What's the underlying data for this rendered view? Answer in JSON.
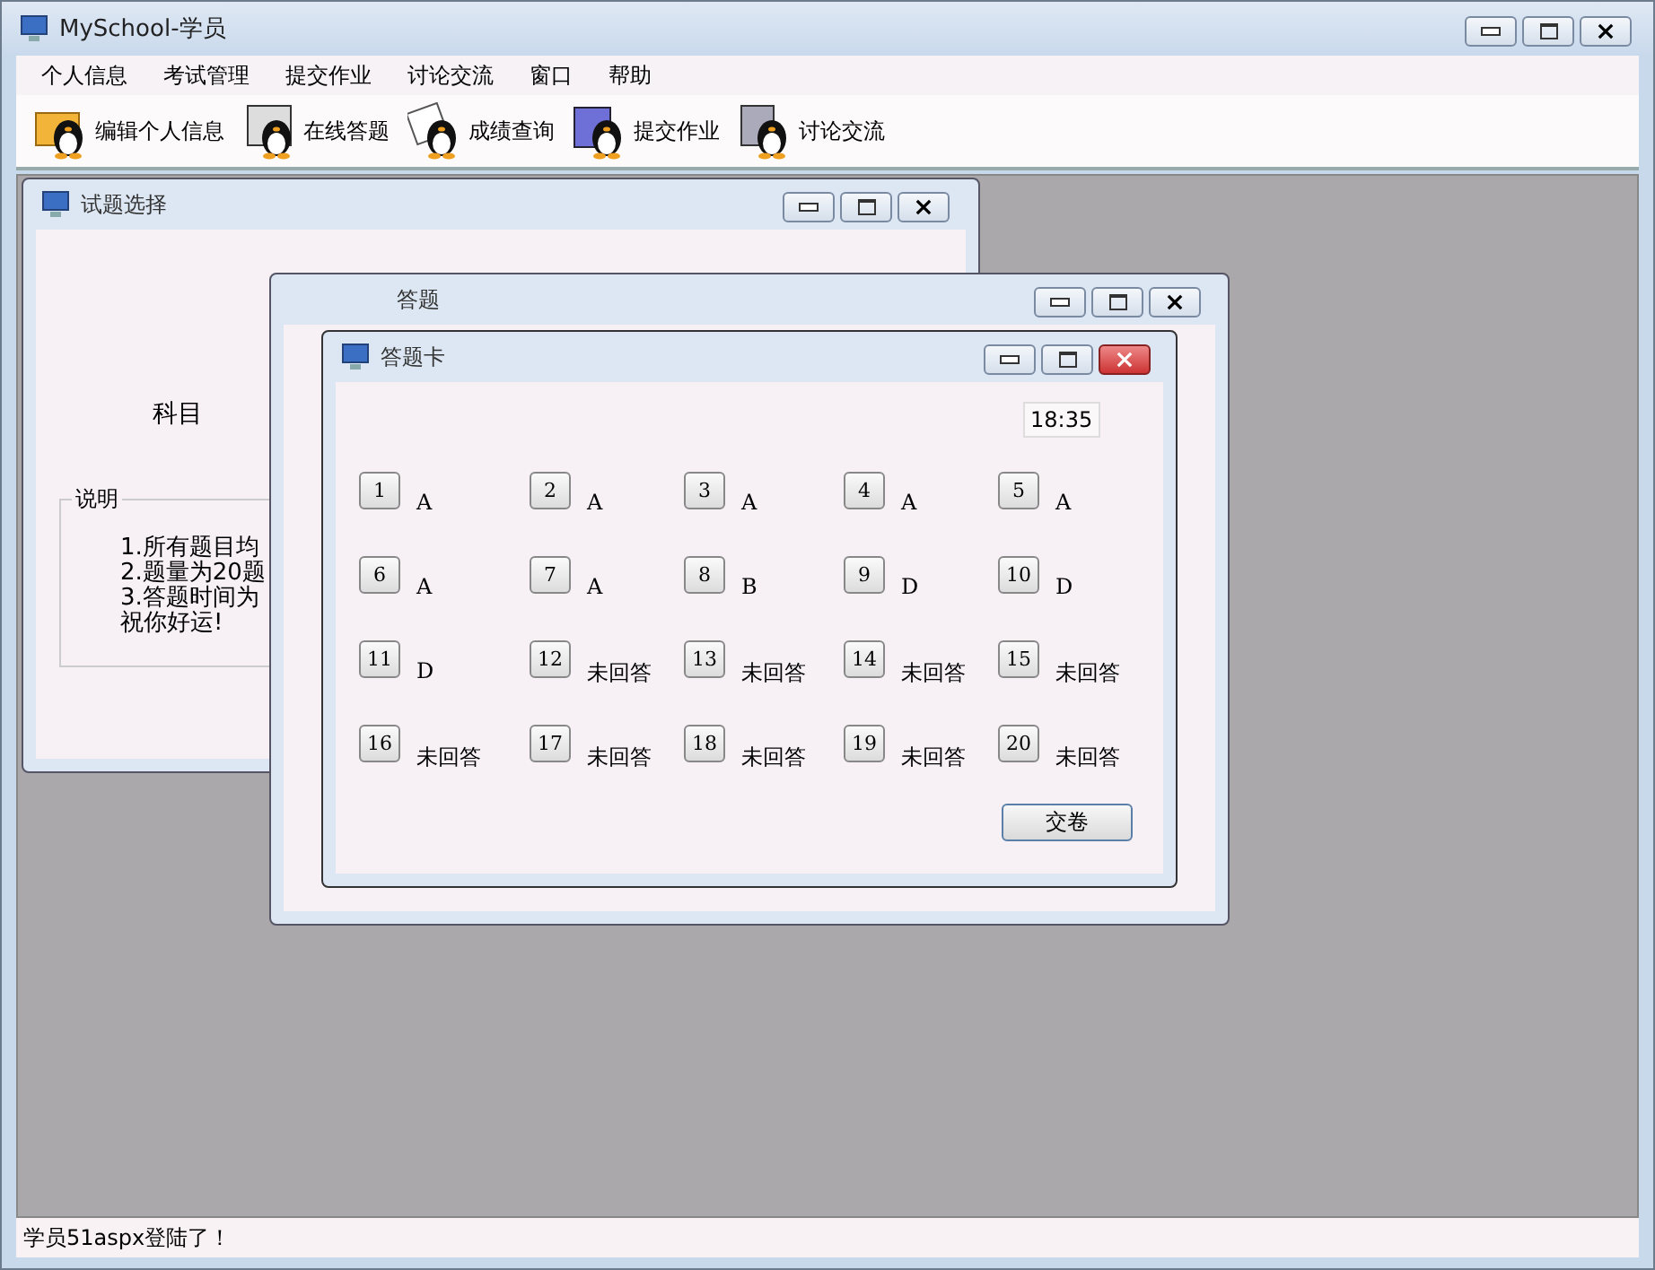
{
  "window": {
    "title": "MySchool-学员"
  },
  "menu": [
    "个人信息",
    "考试管理",
    "提交作业",
    "讨论交流",
    "窗口",
    "帮助"
  ],
  "toolbar": [
    {
      "label": "编辑个人信息",
      "kind": "folder"
    },
    {
      "label": "在线答题",
      "kind": "monitor"
    },
    {
      "label": "成绩查询",
      "kind": "paper"
    },
    {
      "label": "提交作业",
      "kind": "book"
    },
    {
      "label": "讨论交流",
      "kind": "computer"
    }
  ],
  "child_windows": [
    {
      "title": "试题选择",
      "active": false
    },
    {
      "title": "答题",
      "active": false
    },
    {
      "title": "答题卡",
      "active": true
    }
  ],
  "exam_selection": {
    "subject_label": "科目",
    "group_label": "说明",
    "lines": [
      "1.所有题目均",
      "2.题量为20题",
      "3.答题时间为",
      "祝你好运!"
    ]
  },
  "answer_card": {
    "clock": "18:35",
    "submit": "交卷",
    "items": [
      {
        "number": "1",
        "answer": "A"
      },
      {
        "number": "2",
        "answer": "A"
      },
      {
        "number": "3",
        "answer": "A"
      },
      {
        "number": "4",
        "answer": "A"
      },
      {
        "number": "5",
        "answer": "A"
      },
      {
        "number": "6",
        "answer": "A"
      },
      {
        "number": "7",
        "answer": "A"
      },
      {
        "number": "8",
        "answer": "B"
      },
      {
        "number": "9",
        "answer": "D"
      },
      {
        "number": "10",
        "answer": "D"
      },
      {
        "number": "11",
        "answer": "D"
      },
      {
        "number": "12",
        "answer": "未回答"
      },
      {
        "number": "13",
        "answer": "未回答"
      },
      {
        "number": "14",
        "answer": "未回答"
      },
      {
        "number": "15",
        "answer": "未回答"
      },
      {
        "number": "16",
        "answer": "未回答"
      },
      {
        "number": "17",
        "answer": "未回答"
      },
      {
        "number": "18",
        "answer": "未回答"
      },
      {
        "number": "19",
        "answer": "未回答"
      },
      {
        "number": "20",
        "answer": "未回答"
      }
    ]
  },
  "status_bar": "学员51aspx登陆了！"
}
